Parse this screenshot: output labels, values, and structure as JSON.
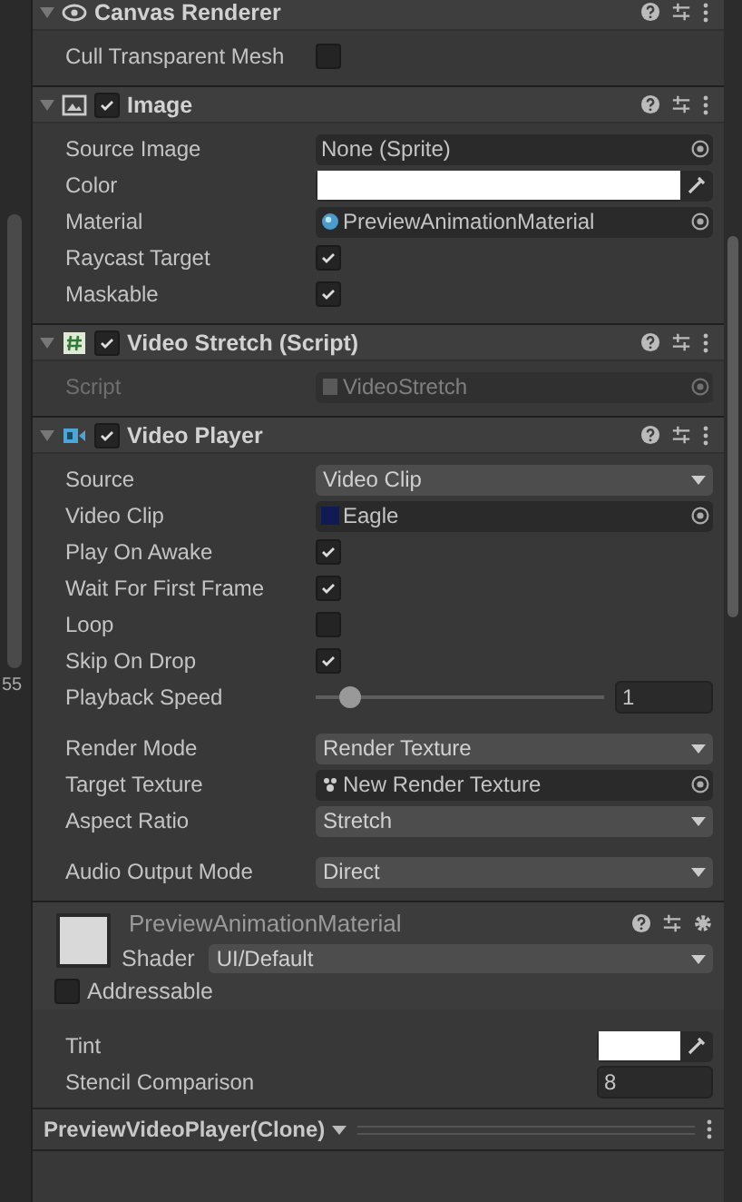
{
  "left_panel": {
    "text": "55"
  },
  "components": [
    {
      "title": "Canvas Renderer",
      "rows": [
        {
          "kind": "checkbox",
          "label": "Cull Transparent Mesh",
          "checked": false
        }
      ]
    },
    {
      "title": "Image",
      "enabled": true,
      "rows": [
        {
          "kind": "object",
          "label": "Source Image",
          "value": "None (Sprite)"
        },
        {
          "kind": "color",
          "label": "Color",
          "color": "#ffffff"
        },
        {
          "kind": "object",
          "label": "Material",
          "value": "PreviewAnimationMaterial"
        },
        {
          "kind": "checkbox",
          "label": "Raycast Target",
          "checked": true
        },
        {
          "kind": "checkbox",
          "label": "Maskable",
          "checked": true
        }
      ]
    },
    {
      "title": "Video Stretch (Script)",
      "enabled": true,
      "rows": [
        {
          "kind": "object",
          "label": "Script",
          "value": "VideoStretch",
          "disabled": true
        }
      ]
    },
    {
      "title": "Video Player",
      "enabled": true,
      "rows": [
        {
          "kind": "dropdown",
          "label": "Source",
          "value": "Video Clip"
        },
        {
          "kind": "object",
          "label": "Video Clip",
          "value": "Eagle"
        },
        {
          "kind": "checkbox",
          "label": "Play On Awake",
          "checked": true
        },
        {
          "kind": "checkbox",
          "label": "Wait For First Frame",
          "checked": true
        },
        {
          "kind": "checkbox",
          "label": "Loop",
          "checked": false
        },
        {
          "kind": "checkbox",
          "label": "Skip On Drop",
          "checked": true
        },
        {
          "kind": "slider",
          "label": "Playback Speed",
          "level": 0.12,
          "value": "1"
        },
        {
          "kind": "dropdown",
          "label": "Render Mode",
          "value": "Render Texture"
        },
        {
          "kind": "object",
          "label": "Target Texture",
          "value": "New Render Texture"
        },
        {
          "kind": "dropdown",
          "label": "Aspect Ratio",
          "value": "Stretch"
        },
        {
          "kind": "dropdown",
          "label": "Audio Output Mode",
          "value": "Direct"
        }
      ]
    }
  ],
  "material": {
    "title": "PreviewAnimationMaterial",
    "shader_label": "Shader",
    "shader": "UI/Default",
    "addressable": {
      "label": "Addressable",
      "checked": false
    },
    "rows": [
      {
        "kind": "color",
        "label": "Tint",
        "color": "#ffffff"
      },
      {
        "kind": "number",
        "label": "Stencil Comparison",
        "value": "8"
      }
    ]
  },
  "bottom_bar": {
    "title": "PreviewVideoPlayer(Clone)"
  }
}
